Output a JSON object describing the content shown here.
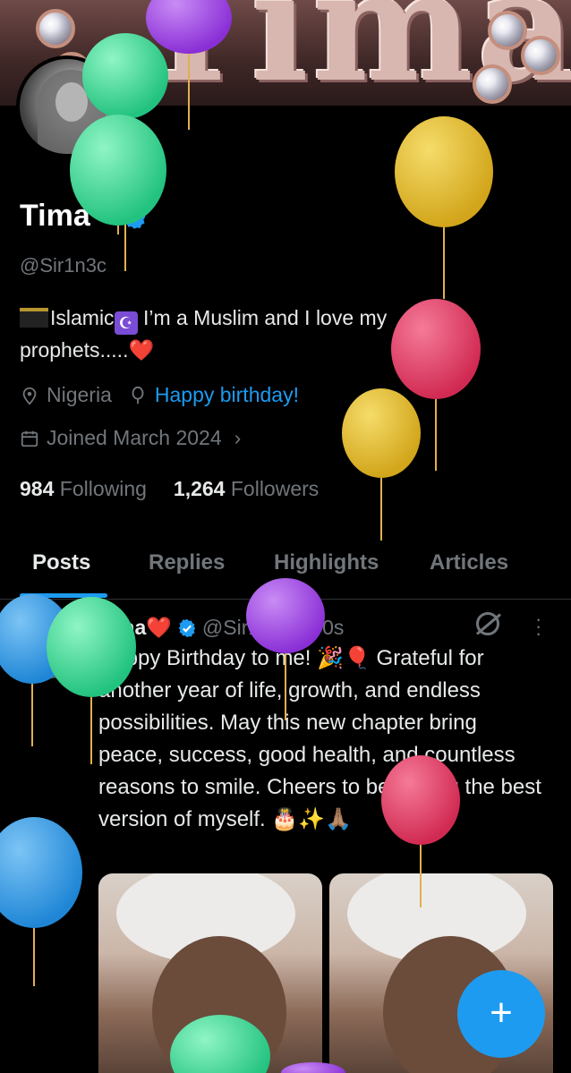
{
  "profile": {
    "name": "Tima",
    "handle": "@Sir1n3c",
    "bio_line1": "Islamic",
    "bio_line1_rest": " I’m a Muslim and I love my",
    "bio_line2": "prophets.....❤️",
    "location": "Nigeria",
    "birthday": "Happy birthday!",
    "joined": "Joined March 2024",
    "following_count": "984",
    "following_label": "Following",
    "followers_count": "1,264",
    "followers_label": "Followers"
  },
  "tabs": [
    {
      "label": "Posts"
    },
    {
      "label": "Replies"
    },
    {
      "label": "Highlights"
    },
    {
      "label": "Articles"
    }
  ],
  "post": {
    "name": "Tima❤️",
    "handle": "@Sir1n3c",
    "time": "· 40s",
    "text": "Happy Birthday to me! 🎉🎈 Grateful for another year of life, growth, and endless possibilities. May this new chapter bring peace, success, good health, and countless reasons to smile. Cheers to becoming the best version of myself. 🎂✨🙏🏽"
  },
  "colors": {
    "accent": "#1d9bf0",
    "muted": "#71767b",
    "text": "#e7e9ea",
    "background": "#000000"
  },
  "icons": [
    "location-icon",
    "balloon-icon",
    "calendar-icon",
    "chevron-right-icon",
    "verified-icon",
    "grok-icon",
    "more-icon",
    "plus-icon"
  ]
}
